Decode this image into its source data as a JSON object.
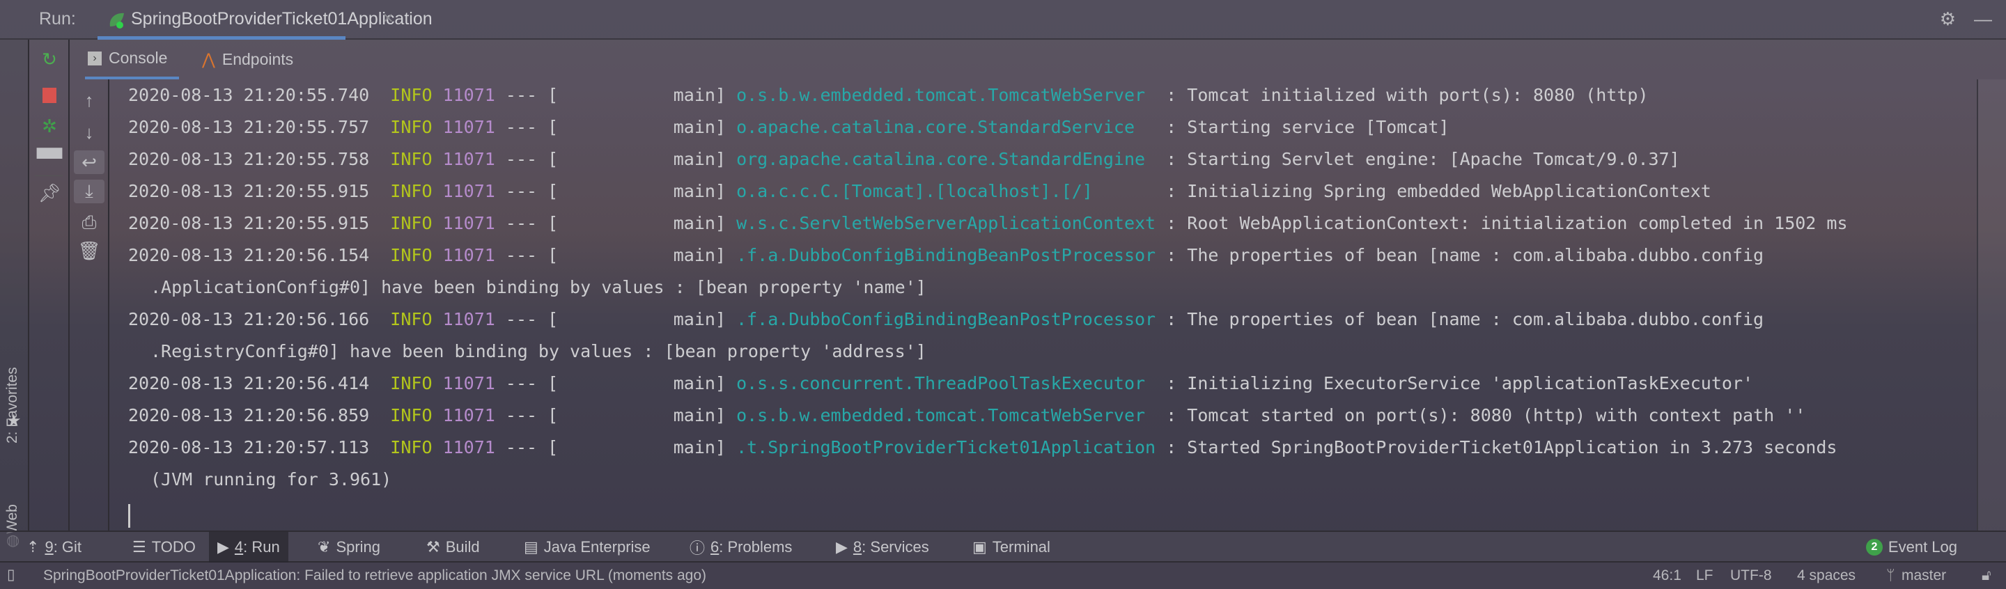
{
  "run_bar": {
    "label": "Run:",
    "tab_title": "SpringBootProviderTicket01Application",
    "close": "×",
    "icons": [
      "gear-icon",
      "minimize-icon"
    ]
  },
  "subtabs": [
    {
      "label": "Console",
      "icon": "console-icon",
      "active": true
    },
    {
      "label": "Endpoints",
      "icon": "endpoints-icon",
      "active": false
    }
  ],
  "left_strip": {
    "favorites": "2: Favorites",
    "web": "Web"
  },
  "toolbar_icons": [
    "rerun-icon",
    "stop-icon",
    "debug-attach-icon",
    "layout-icon",
    "pin-icon"
  ],
  "console_icons": [
    "arrow-up-icon",
    "arrow-down-icon",
    "soft-wrap-icon",
    "scroll-to-end-icon",
    "print-icon",
    "trash-icon"
  ],
  "colors": {
    "info": "#b3c61c",
    "pid": "#b58bcb",
    "logger": "#27a8a8",
    "accent": "#5a86c2",
    "stop": "#d9534f",
    "run_green": "#3fa14a"
  },
  "log": [
    {
      "ts": "2020-08-13 21:20:55.740",
      "level": "INFO",
      "pid": "11071",
      "sep": "---",
      "thread": "[           main]",
      "logger": "o.s.b.w.embedded.tomcat.TomcatWebServer  ",
      "msg": ": Tomcat initialized with port(s): 8080 (http)"
    },
    {
      "ts": "2020-08-13 21:20:55.757",
      "level": "INFO",
      "pid": "11071",
      "sep": "---",
      "thread": "[           main]",
      "logger": "o.apache.catalina.core.StandardService   ",
      "msg": ": Starting service [Tomcat]"
    },
    {
      "ts": "2020-08-13 21:20:55.758",
      "level": "INFO",
      "pid": "11071",
      "sep": "---",
      "thread": "[           main]",
      "logger": "org.apache.catalina.core.StandardEngine  ",
      "msg": ": Starting Servlet engine: [Apache Tomcat/9.0.37]"
    },
    {
      "ts": "2020-08-13 21:20:55.915",
      "level": "INFO",
      "pid": "11071",
      "sep": "---",
      "thread": "[           main]",
      "logger": "o.a.c.c.C.[Tomcat].[localhost].[/]       ",
      "msg": ": Initializing Spring embedded WebApplicationContext"
    },
    {
      "ts": "2020-08-13 21:20:55.915",
      "level": "INFO",
      "pid": "11071",
      "sep": "---",
      "thread": "[           main]",
      "logger": "w.s.c.ServletWebServerApplicationContext ",
      "msg": ": Root WebApplicationContext: initialization completed in 1502 ms"
    },
    {
      "ts": "2020-08-13 21:20:56.154",
      "level": "INFO",
      "pid": "11071",
      "sep": "---",
      "thread": "[           main]",
      "logger": ".f.a.DubboConfigBindingBeanPostProcessor ",
      "msg": ": The properties of bean [name : com.alibaba.dubbo.config",
      "cont": ".ApplicationConfig#0] have been binding by values : [bean property 'name']"
    },
    {
      "ts": "2020-08-13 21:20:56.166",
      "level": "INFO",
      "pid": "11071",
      "sep": "---",
      "thread": "[           main]",
      "logger": ".f.a.DubboConfigBindingBeanPostProcessor ",
      "msg": ": The properties of bean [name : com.alibaba.dubbo.config",
      "cont": ".RegistryConfig#0] have been binding by values : [bean property 'address']"
    },
    {
      "ts": "2020-08-13 21:20:56.414",
      "level": "INFO",
      "pid": "11071",
      "sep": "---",
      "thread": "[           main]",
      "logger": "o.s.s.concurrent.ThreadPoolTaskExecutor  ",
      "msg": ": Initializing ExecutorService 'applicationTaskExecutor'"
    },
    {
      "ts": "2020-08-13 21:20:56.859",
      "level": "INFO",
      "pid": "11071",
      "sep": "---",
      "thread": "[           main]",
      "logger": "o.s.b.w.embedded.tomcat.TomcatWebServer  ",
      "msg": ": Tomcat started on port(s): 8080 (http) with context path ''"
    },
    {
      "ts": "2020-08-13 21:20:57.113",
      "level": "INFO",
      "pid": "11071",
      "sep": "---",
      "thread": "[           main]",
      "logger": ".t.SpringBootProviderTicket01Application ",
      "msg": ": Started SpringBootProviderTicket01Application in 3.273 seconds",
      "cont": "(JVM running for 3.961)"
    }
  ],
  "tool_windows": [
    {
      "num": "9",
      "label": ": Git",
      "icon": "git-icon"
    },
    {
      "num": "",
      "label": "TODO",
      "icon": "todo-icon"
    },
    {
      "num": "4",
      "label": ": Run",
      "icon": "run-icon",
      "active": true
    },
    {
      "num": "",
      "label": "Spring",
      "icon": "spring-icon"
    },
    {
      "num": "",
      "label": "Build",
      "icon": "build-icon"
    },
    {
      "num": "",
      "label": "Java Enterprise",
      "icon": "java-enterprise-icon"
    },
    {
      "num": "6",
      "label": ": Problems",
      "icon": "problems-icon"
    },
    {
      "num": "8",
      "label": ": Services",
      "icon": "services-icon"
    },
    {
      "num": "",
      "label": "Terminal",
      "icon": "terminal-icon"
    }
  ],
  "event_log": {
    "count": "2",
    "label": "Event Log"
  },
  "status": {
    "message": "SpringBootProviderTicket01Application: Failed to retrieve application JMX service URL (moments ago)",
    "position": "46:1",
    "line_sep": "LF",
    "encoding": "UTF-8",
    "indent": "4 spaces",
    "branch": "master"
  }
}
